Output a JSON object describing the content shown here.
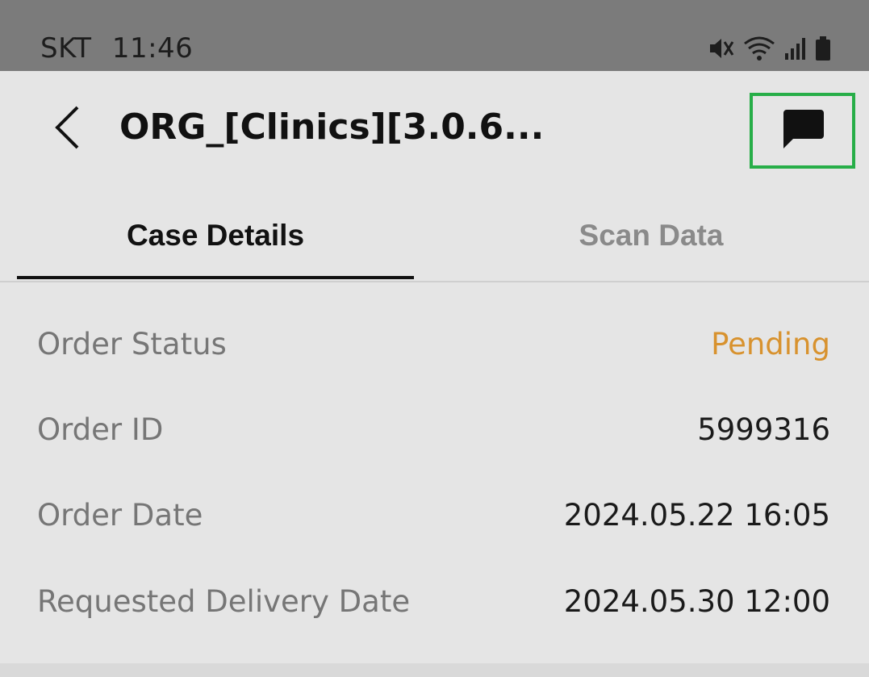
{
  "status_bar": {
    "carrier": "SKT",
    "time": "11:46",
    "icons": [
      "mute-icon",
      "wifi-icon",
      "signal-icon",
      "battery-icon"
    ]
  },
  "header": {
    "title": "ORG_[Clinics][3.0.6...",
    "back_icon": "chevron-left-icon",
    "chat_icon": "chat-bubble-icon",
    "highlight_color": "#27ae48"
  },
  "tabs": [
    {
      "label": "Case Details",
      "active": true
    },
    {
      "label": "Scan Data",
      "active": false
    }
  ],
  "details": [
    {
      "label": "Order Status",
      "value": "Pending"
    },
    {
      "label": "Order ID",
      "value": "5999316"
    },
    {
      "label": "Order Date",
      "value": "2024.05.22 16:05"
    },
    {
      "label": "Requested Delivery Date",
      "value": "2024.05.30 12:00"
    }
  ],
  "colors": {
    "pending": "#d8922e",
    "background": "#e5e5e5",
    "status_bar": "#7b7b7b"
  }
}
